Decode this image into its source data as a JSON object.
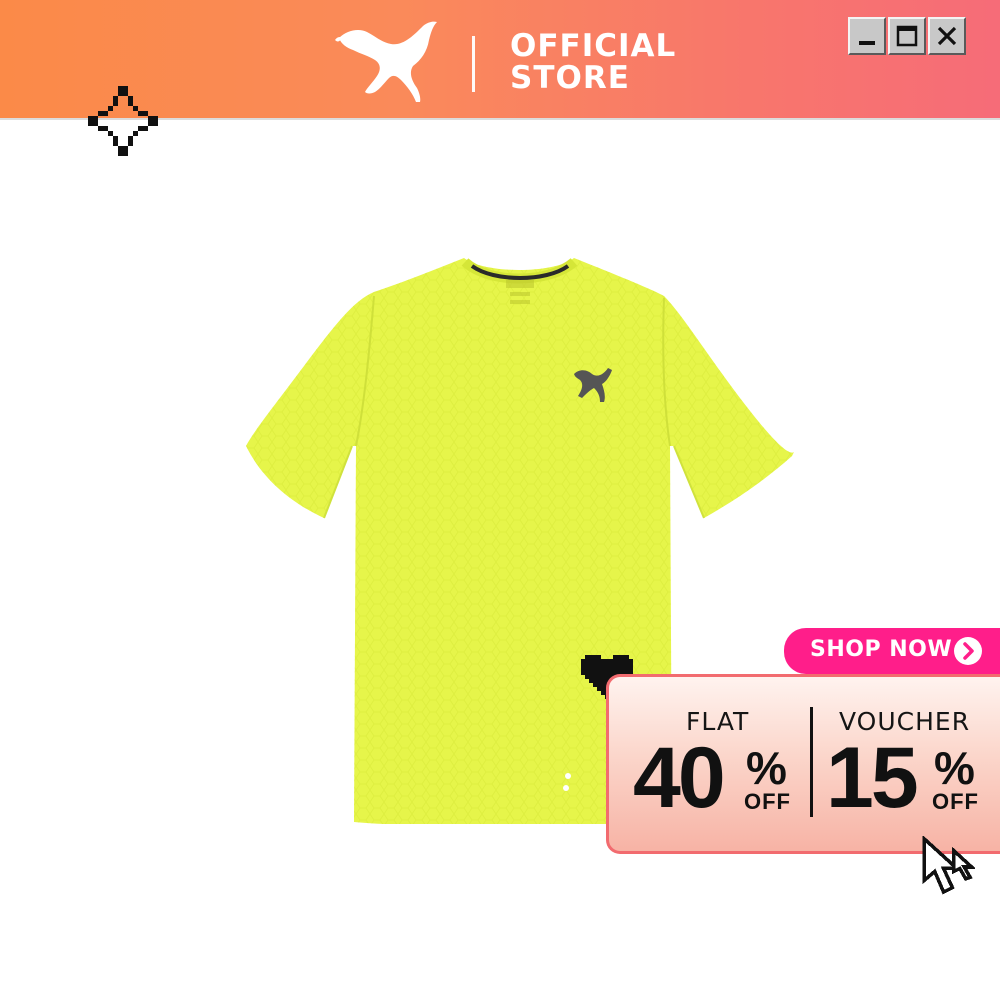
{
  "header": {
    "brand_line1": "OFFICIAL",
    "brand_line2": "STORE",
    "brand_color": "#ffffff",
    "gradient_start": "#fb8a48",
    "gradient_end": "#f66c78"
  },
  "window_controls": {
    "minimize_icon": "minimize-icon",
    "maximize_icon": "maximize-icon",
    "close_icon": "close-icon"
  },
  "product": {
    "color": "#e6f54a",
    "chest_logo": "puma-cat-logo"
  },
  "promo": {
    "shop_now_label": "SHOP NOW",
    "shop_now_color": "#ff1e8a",
    "flat_label": "FLAT",
    "flat_value": "40",
    "flat_percent": "%",
    "flat_off": "OFF",
    "voucher_label": "VOUCHER",
    "voucher_value": "15",
    "voucher_percent": "%",
    "voucher_off": "OFF"
  },
  "decorations": {
    "sparkle_icon": "pixel-sparkle-icon",
    "heart_icon": "pixel-heart-icon",
    "cursor_icon": "pixel-cursor-icon"
  }
}
